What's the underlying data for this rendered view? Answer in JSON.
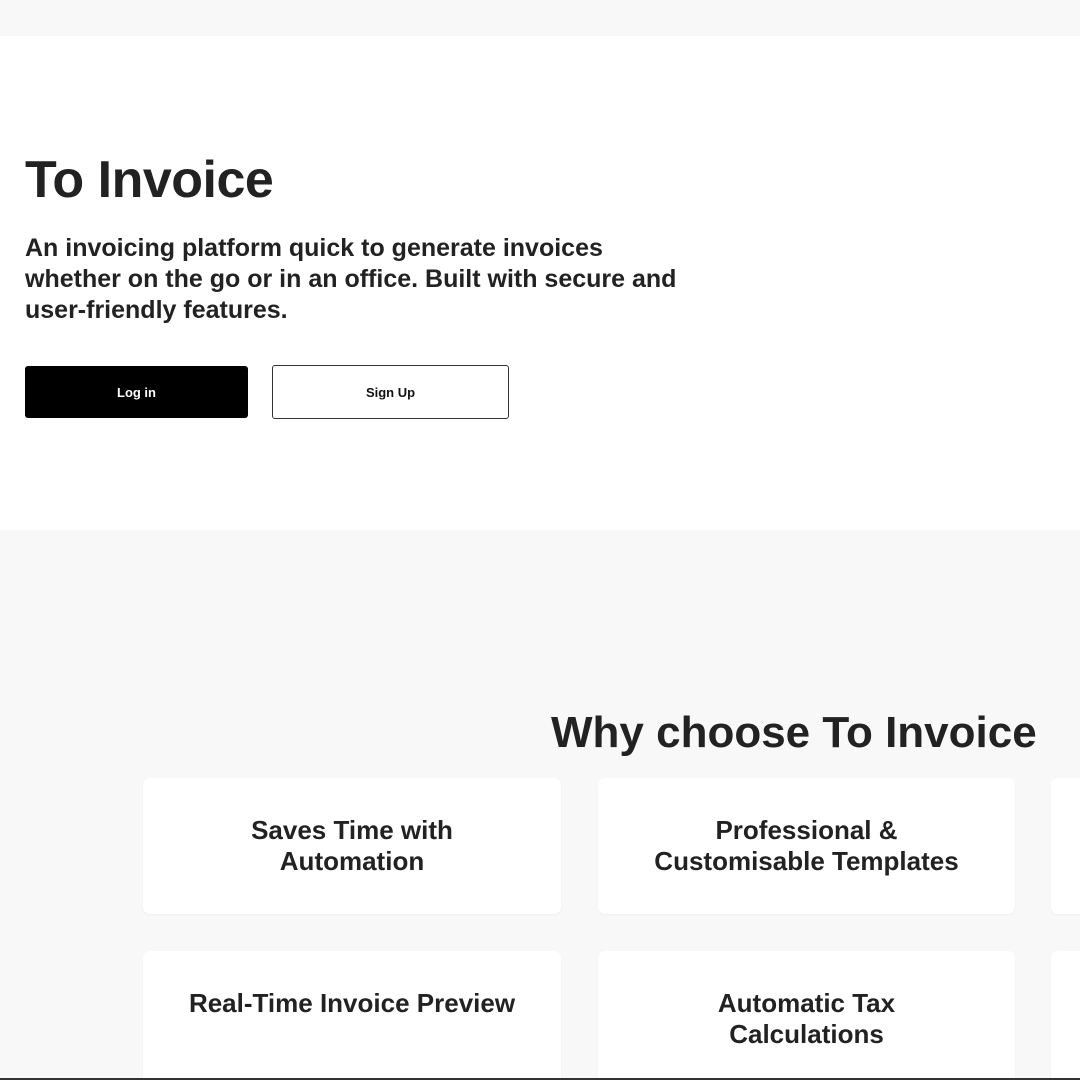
{
  "hero": {
    "title": "To Invoice",
    "description": "An invoicing platform quick to generate invoices whether on the go or in an office. Built with secure and user-friendly features.",
    "login_label": "Log in",
    "signup_label": "Sign Up"
  },
  "features": {
    "heading": "Why choose To Invoice",
    "cards": [
      {
        "title": "Saves Time with Automation"
      },
      {
        "title": "Professional & Customisable Templates"
      },
      {
        "title": ""
      },
      {
        "title": "Real-Time Invoice Preview"
      },
      {
        "title": "Automatic Tax Calculations"
      },
      {
        "title": ""
      }
    ]
  },
  "colors": {
    "page_background": "#f8f8f8",
    "hero_background": "#ffffff",
    "primary_button": "#000000",
    "text": "#222222"
  }
}
